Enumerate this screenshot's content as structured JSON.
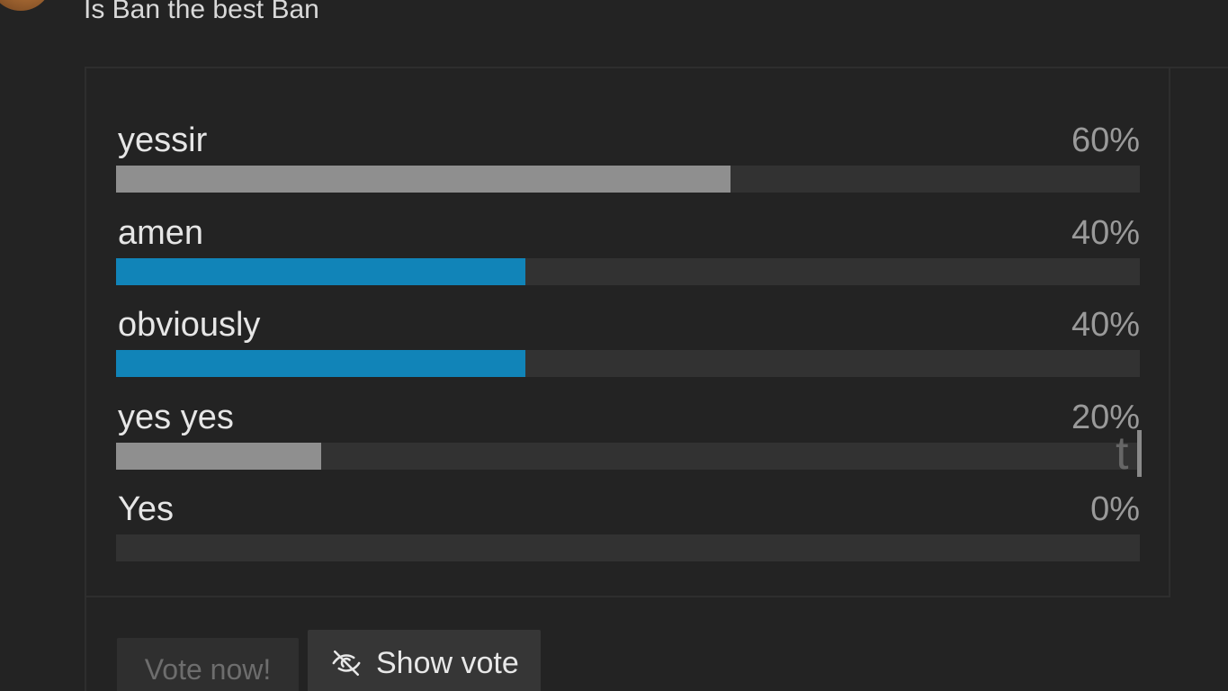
{
  "poll": {
    "question": "Is Ban the best Ban",
    "options": [
      {
        "label": "yessir",
        "percent_label": "60%",
        "fraction": 0.6,
        "color": "#8f8f8f"
      },
      {
        "label": "amen",
        "percent_label": "40%",
        "fraction": 0.4,
        "color": "#1184b8"
      },
      {
        "label": "obviously",
        "percent_label": "40%",
        "fraction": 0.4,
        "color": "#1184b8"
      },
      {
        "label": "yes yes",
        "percent_label": "20%",
        "fraction": 0.2,
        "color": "#8f8f8f"
      },
      {
        "label": "Yes",
        "percent_label": "0%",
        "fraction": 0.0,
        "color": "#8f8f8f"
      }
    ]
  },
  "side_panel": {
    "partial_text": "t"
  },
  "actions": {
    "vote_label": "Vote now!",
    "show_vote_label": "Show vote",
    "show_vote_icon": "eye-slash-icon"
  }
}
